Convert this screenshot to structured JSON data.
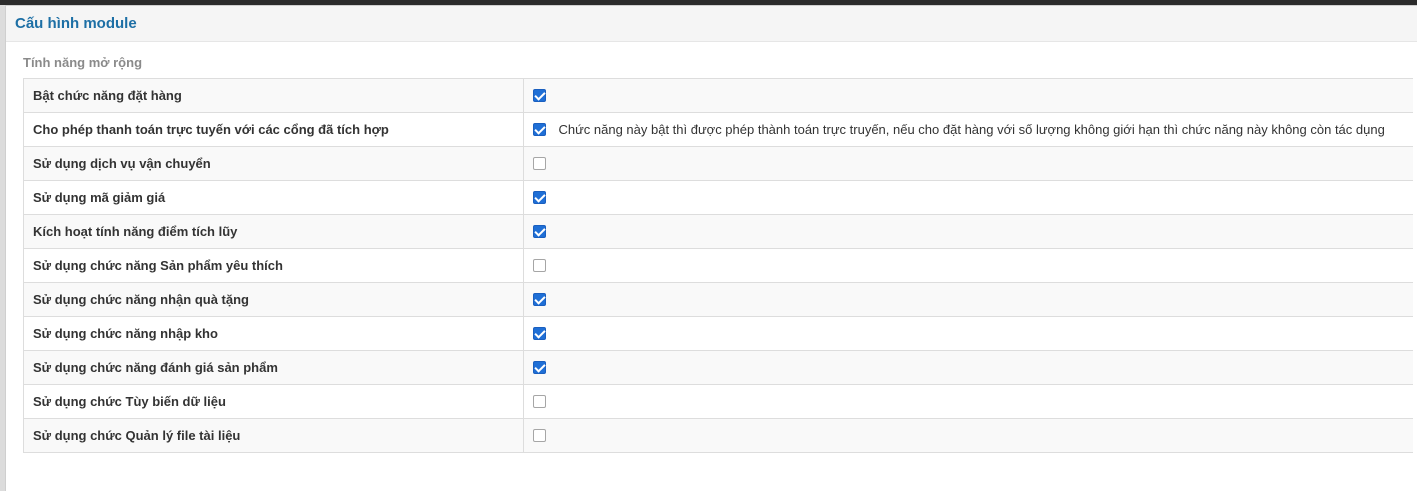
{
  "panel": {
    "title": "Cấu hình module"
  },
  "section": {
    "title": "Tính năng mở rộng"
  },
  "rows": [
    {
      "label": "Bật chức năng đặt hàng",
      "checked": true,
      "help": ""
    },
    {
      "label": "Cho phép thanh toán trực tuyến với các cổng đã tích hợp",
      "checked": true,
      "help": "Chức năng này bật thì được phép thành toán trực truyến, nếu cho đặt hàng với số lượng không giới hạn thì chức năng này không còn tác dụng"
    },
    {
      "label": "Sử dụng dịch vụ vận chuyển",
      "checked": false,
      "help": ""
    },
    {
      "label": "Sử dụng mã giảm giá",
      "checked": true,
      "help": ""
    },
    {
      "label": "Kích hoạt tính năng điểm tích lũy",
      "checked": true,
      "help": ""
    },
    {
      "label": "Sử dụng chức năng Sản phẩm yêu thích",
      "checked": false,
      "help": ""
    },
    {
      "label": "Sử dụng chức năng nhận quà tặng",
      "checked": true,
      "help": ""
    },
    {
      "label": "Sử dụng chức năng nhập kho",
      "checked": true,
      "help": ""
    },
    {
      "label": "Sử dụng chức năng đánh giá sản phẩm",
      "checked": true,
      "help": ""
    },
    {
      "label": "Sử dụng chức Tùy biến dữ liệu",
      "checked": false,
      "help": ""
    },
    {
      "label": "Sử dụng chức Quản lý file tài liệu",
      "checked": false,
      "help": ""
    }
  ]
}
